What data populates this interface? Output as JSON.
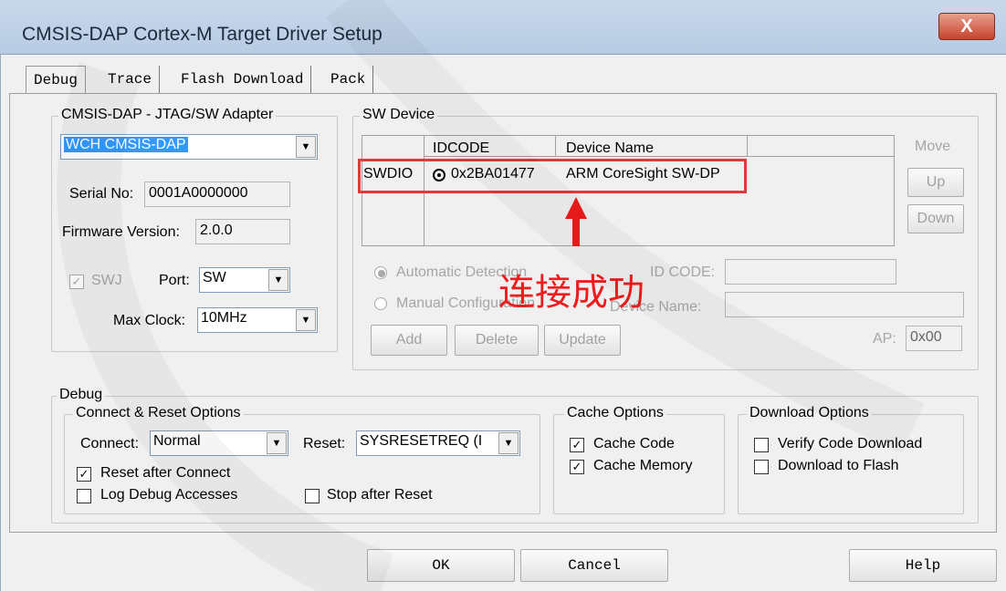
{
  "window": {
    "title": "CMSIS-DAP Cortex-M Target Driver Setup",
    "close_glyph": "X"
  },
  "tabs": [
    "Debug",
    "Trace",
    "Flash Download",
    "Pack"
  ],
  "adapter": {
    "group_label": "CMSIS-DAP - JTAG/SW Adapter",
    "selected": "WCH CMSIS-DAP",
    "serial_label": "Serial No:",
    "serial_value": "0001A0000000",
    "firmware_label": "Firmware Version:",
    "firmware_value": "2.0.0",
    "swj_label": "SWJ",
    "port_label": "Port:",
    "port_value": "SW",
    "max_clock_label": "Max Clock:",
    "max_clock_value": "10MHz"
  },
  "sw_device": {
    "group_label": "SW Device",
    "columns": [
      "IDCODE",
      "Device Name"
    ],
    "row_label": "SWDIO",
    "row_idcode": "0x2BA01477",
    "row_device": "ARM CoreSight SW-DP",
    "move_label": "Move",
    "up_label": "Up",
    "down_label": "Down",
    "auto_label": "Automatic Detection",
    "manual_label": "Manual Configuration",
    "id_code_label": "ID CODE:",
    "device_name_label": "Device Name:",
    "add_label": "Add",
    "delete_label": "Delete",
    "update_label": "Update",
    "ap_label": "AP:",
    "ap_value": "0x00"
  },
  "annotation": "连接成功",
  "debug": {
    "group_label": "Debug",
    "connect_reset": {
      "label": "Connect & Reset Options",
      "connect_label": "Connect:",
      "connect_value": "Normal",
      "reset_label": "Reset:",
      "reset_value": "SYSRESETREQ (I",
      "reset_after_connect": "Reset after Connect",
      "log_debug": "Log Debug Accesses",
      "stop_after_reset": "Stop after Reset"
    },
    "cache": {
      "label": "Cache Options",
      "code": "Cache Code",
      "memory": "Cache Memory"
    },
    "download": {
      "label": "Download Options",
      "verify": "Verify Code Download",
      "to_flash": "Download to Flash"
    }
  },
  "footer": {
    "ok": "OK",
    "cancel": "Cancel",
    "help": "Help"
  },
  "check_glyph": "✓",
  "dropdown_glyph": "▼",
  "colors": {
    "accent_red": "#ee1c1c",
    "selection_blue": "#3399ff",
    "titlebar": "#c9d9ec"
  }
}
